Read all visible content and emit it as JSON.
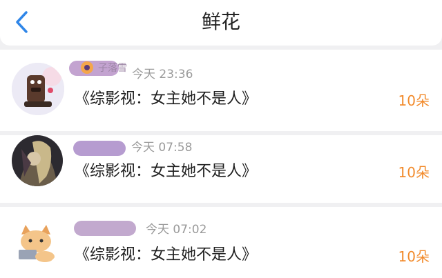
{
  "header": {
    "title": "鲜花",
    "back_icon": "chevron-left-icon"
  },
  "colors": {
    "accent": "#f28b2c",
    "back": "#2f86e8",
    "muted": "#9a9a9a",
    "mask": "#c9aac6"
  },
  "entries": [
    {
      "name": "子落雪",
      "time": "今天 23:36",
      "book": "《综影视：女主她不是人》",
      "count": "10朵"
    },
    {
      "name": "",
      "time": "今天 07:58",
      "book": "《综影视：女主她不是人》",
      "count": "10朵"
    },
    {
      "name": "",
      "time": "今天 07:02",
      "book": "《综影视：女主她不是人》",
      "count": "10朵"
    }
  ]
}
